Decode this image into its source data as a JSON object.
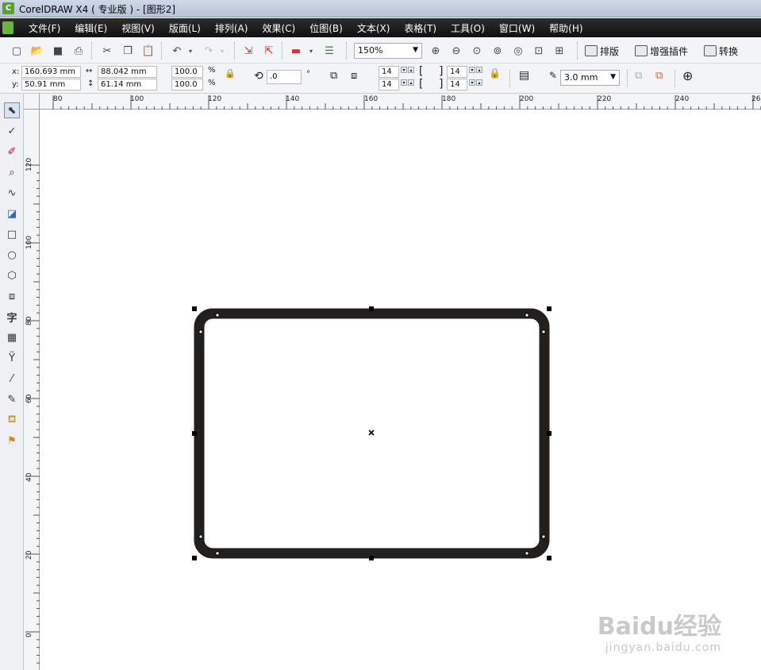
{
  "window": {
    "title": "CorelDRAW X4 ( 专业版 ) - [图形2]"
  },
  "menu": [
    "文件(F)",
    "编辑(E)",
    "视图(V)",
    "版面(L)",
    "排列(A)",
    "效果(C)",
    "位图(B)",
    "文本(X)",
    "表格(T)",
    "工具(O)",
    "窗口(W)",
    "帮助(H)"
  ],
  "toolbar": {
    "zoom_value": "150%",
    "btn_layout": "排版",
    "btn_plugins": "增强插件",
    "btn_convert": "转换"
  },
  "property_bar": {
    "x_label": "x:",
    "x_value": "160.693 mm",
    "y_label": "y:",
    "y_value": "50.91 mm",
    "w_value": "88.042 mm",
    "h_value": "61.14 mm",
    "scale_x": "100.0",
    "scale_y": "100.0",
    "percent": "%",
    "rotation": ".0",
    "degree": "°",
    "corner_tl": "14",
    "corner_bl": "14",
    "corner_tr": "14",
    "corner_br": "14",
    "outline_width": "3.0 mm"
  },
  "rulers": {
    "horizontal": [
      "80",
      "100",
      "120",
      "140",
      "160",
      "180",
      "200",
      "220",
      "240",
      "26"
    ],
    "vertical": [
      "120",
      "100",
      "80",
      "60",
      "40",
      "20",
      "0"
    ]
  },
  "shape": {
    "type": "rounded-rectangle",
    "outline_color": "#231f1c",
    "fill": "#ffffff"
  },
  "watermark": {
    "main": "Baidu经验",
    "sub": "jingyan.baidu.com"
  }
}
